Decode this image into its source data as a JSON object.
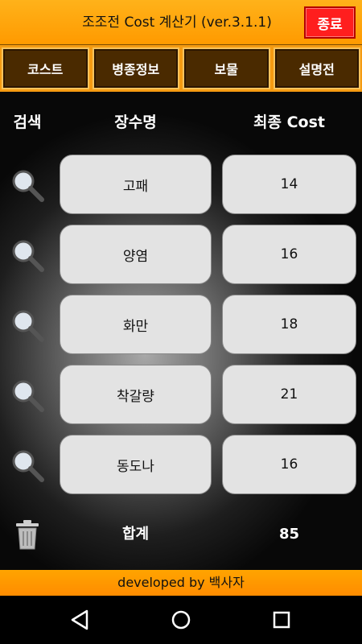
{
  "header": {
    "title": "조조전 Cost 계산기 (ver.3.1.1)",
    "close_label": "종료"
  },
  "tabs": [
    {
      "label": "코스트"
    },
    {
      "label": "병종정보"
    },
    {
      "label": "보물"
    },
    {
      "label": "설명전"
    }
  ],
  "table": {
    "col_search": "검색",
    "col_name": "장수명",
    "col_cost": "최종 Cost",
    "rows": [
      {
        "name": "고패",
        "cost": "14"
      },
      {
        "name": "양염",
        "cost": "16"
      },
      {
        "name": "화만",
        "cost": "18"
      },
      {
        "name": "착갈량",
        "cost": "21"
      },
      {
        "name": "동도나",
        "cost": "16"
      }
    ],
    "total_label": "합계",
    "total_value": "85"
  },
  "footer": {
    "text": "developed by 백사자"
  },
  "colors": {
    "header_bg": "#ff9a00",
    "close_bg": "#ff1e1e",
    "tab_bg": "#4a2a00",
    "cell_bg": "#e3e3e3"
  },
  "icons": {
    "search": "magnifier",
    "trash": "trash-can",
    "nav": [
      "back-triangle",
      "home-circle",
      "recents-square"
    ]
  }
}
